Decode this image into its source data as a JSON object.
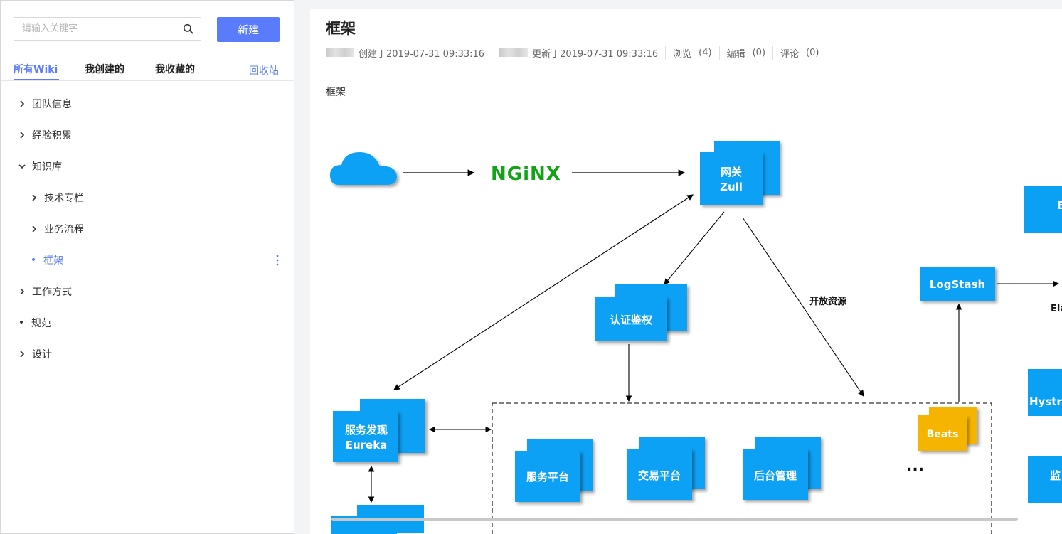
{
  "sidebar": {
    "search_placeholder": "请输入关键字",
    "new_button": "新建",
    "tabs": [
      "所有Wiki",
      "我创建的",
      "我收藏的"
    ],
    "recycle": "回收站",
    "tree": [
      {
        "label": "团队信息",
        "state": "collapsed"
      },
      {
        "label": "经验积累",
        "state": "collapsed"
      },
      {
        "label": "知识库",
        "state": "expanded"
      },
      {
        "label": "技术专栏",
        "state": "collapsed"
      },
      {
        "label": "业务流程",
        "state": "collapsed"
      },
      {
        "label": "框架",
        "state": "leaf-active"
      },
      {
        "label": "工作方式",
        "state": "collapsed"
      },
      {
        "label": "规范",
        "state": "leaf"
      },
      {
        "label": "设计",
        "state": "collapsed"
      }
    ]
  },
  "page": {
    "title": "框架",
    "created": "创建于2019-07-31 09:33:16",
    "updated": "更新于2019-07-31 09:33:16",
    "views_label": "浏览",
    "views_count": "(4)",
    "edits_label": "编辑",
    "edits_count": "(0)",
    "comments_label": "评论",
    "comments_count": "(0)",
    "body": "框架"
  },
  "diagram": {
    "nginx": "NGiNX",
    "gateway_line1": "网关",
    "gateway_line2": "Zull",
    "auth": "认证鉴权",
    "open_resources": "开放资源",
    "logstash": "LogStash",
    "discovery_line1": "服务发现",
    "discovery_line2": "Eureka",
    "service_platform": "服务平台",
    "trade_platform": "交易平台",
    "backend_admin": "后台管理",
    "beats": "Beats",
    "ellipsis": "...",
    "elastic_partial": "Ela",
    "hystrix_partial": "Hystr",
    "monitor_partial": "监",
    "top_right_partial": "E"
  },
  "colors": {
    "accent": "#5b7cfa",
    "node_blue": "#0aa1f5",
    "node_yellow": "#f5b400",
    "nginx_green": "#12a317"
  }
}
